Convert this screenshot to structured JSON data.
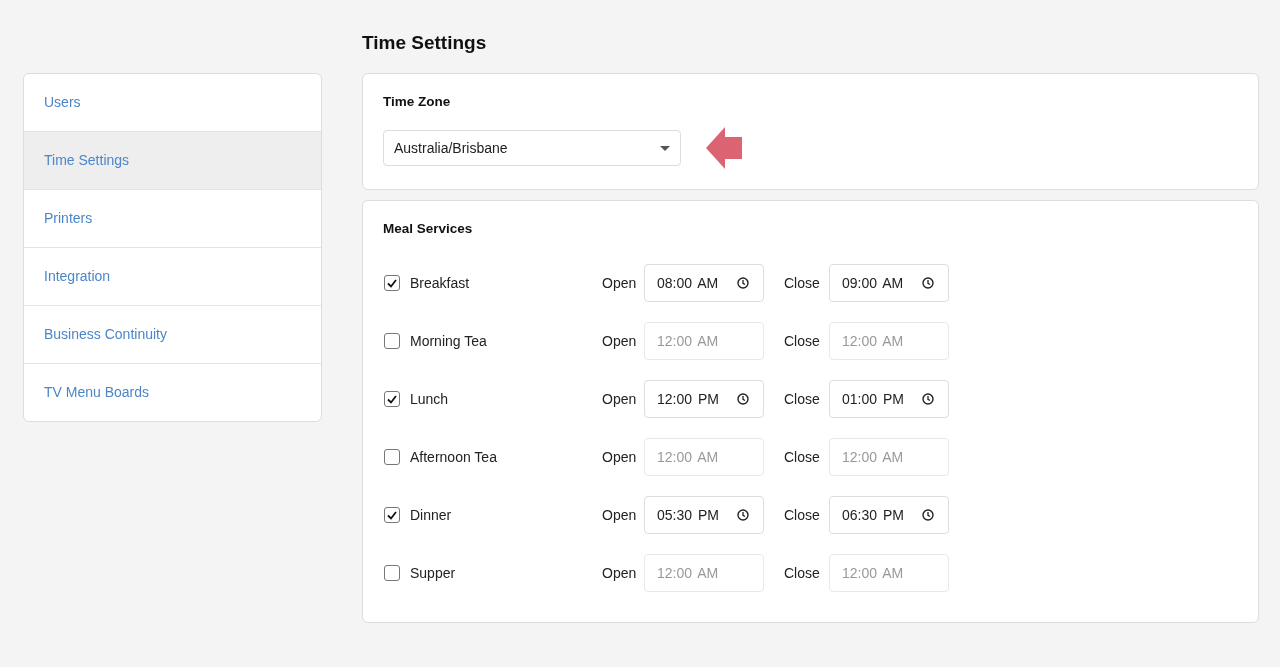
{
  "sidebar": {
    "items": [
      {
        "label": "Users",
        "selected": false
      },
      {
        "label": "Time Settings",
        "selected": true
      },
      {
        "label": "Printers",
        "selected": false
      },
      {
        "label": "Integration",
        "selected": false
      },
      {
        "label": "Business Continuity",
        "selected": false
      },
      {
        "label": "TV Menu Boards",
        "selected": false
      }
    ]
  },
  "page_title": "Time Settings",
  "time_zone": {
    "heading": "Time Zone",
    "value": "Australia/Brisbane"
  },
  "meal_services": {
    "heading": "Meal Services",
    "meals": [
      {
        "name": "Breakfast",
        "checked": true,
        "open_label": "Open",
        "open": "08:00 AM",
        "close_label": "Close",
        "close": "09:00 AM"
      },
      {
        "name": "Morning Tea",
        "checked": false,
        "open_label": "Open",
        "open": "12:00 AM",
        "close_label": "Close",
        "close": "12:00 AM"
      },
      {
        "name": "Lunch",
        "checked": true,
        "open_label": "Open",
        "open": "12:00 PM",
        "close_label": "Close",
        "close": "01:00 PM"
      },
      {
        "name": "Afternoon Tea",
        "checked": false,
        "open_label": "Open",
        "open": "12:00 AM",
        "close_label": "Close",
        "close": "12:00 AM"
      },
      {
        "name": "Dinner",
        "checked": true,
        "open_label": "Open",
        "open": "05:30 PM",
        "close_label": "Close",
        "close": "06:30 PM"
      },
      {
        "name": "Supper",
        "checked": false,
        "open_label": "Open",
        "open": "12:00 AM",
        "close_label": "Close",
        "close": "12:00 AM"
      }
    ]
  }
}
